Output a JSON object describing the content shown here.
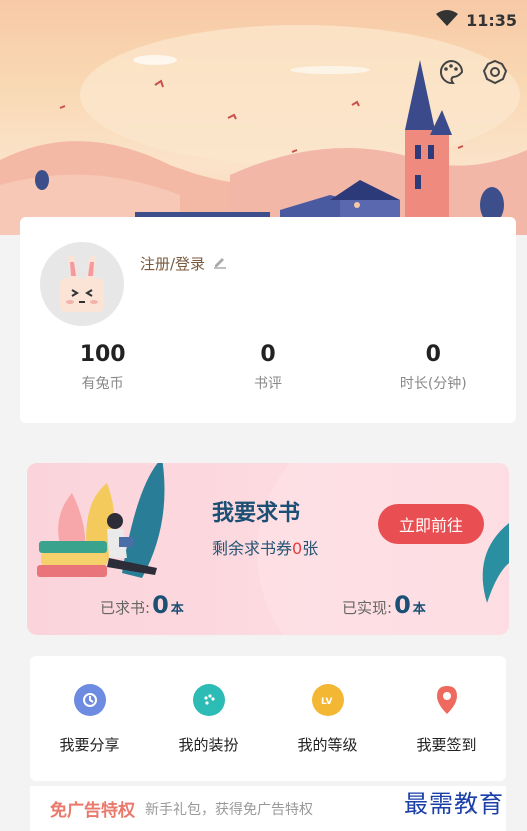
{
  "status_bar": {
    "time": "11:35",
    "wifi_icon": "wifi-icon"
  },
  "header": {
    "icons": [
      "palette-icon",
      "settings-icon"
    ]
  },
  "profile": {
    "login_label": "注册/登录",
    "edit_icon": "pencil-icon",
    "stats": [
      {
        "value": "100",
        "label": "有兔币"
      },
      {
        "value": "0",
        "label": "书评"
      },
      {
        "value": "0",
        "label": "时长(分钟)"
      }
    ]
  },
  "request_book": {
    "title": "我要求书",
    "subtitle_prefix": "剩余求书券",
    "subtitle_count": "0",
    "subtitle_suffix": "张",
    "button": "立即前往",
    "requested_label": "已求书:",
    "requested_value": "0",
    "requested_unit": "本",
    "fulfilled_label": "已实现:",
    "fulfilled_value": "0",
    "fulfilled_unit": "本"
  },
  "shortcuts": [
    {
      "label": "我要分享",
      "icon": "share-icon",
      "color": "#6d8be0"
    },
    {
      "label": "我的装扮",
      "icon": "palette-icon",
      "color": "#2cbcb5"
    },
    {
      "label": "我的等级",
      "icon": "level-icon",
      "color": "#f3b733"
    },
    {
      "label": "我要签到",
      "icon": "location-icon",
      "color": "#ee6a5f"
    }
  ],
  "ad_free": {
    "tag": "免广告特权",
    "desc": "新手礼包，获得免广告特权"
  },
  "watermark": "最需教育"
}
